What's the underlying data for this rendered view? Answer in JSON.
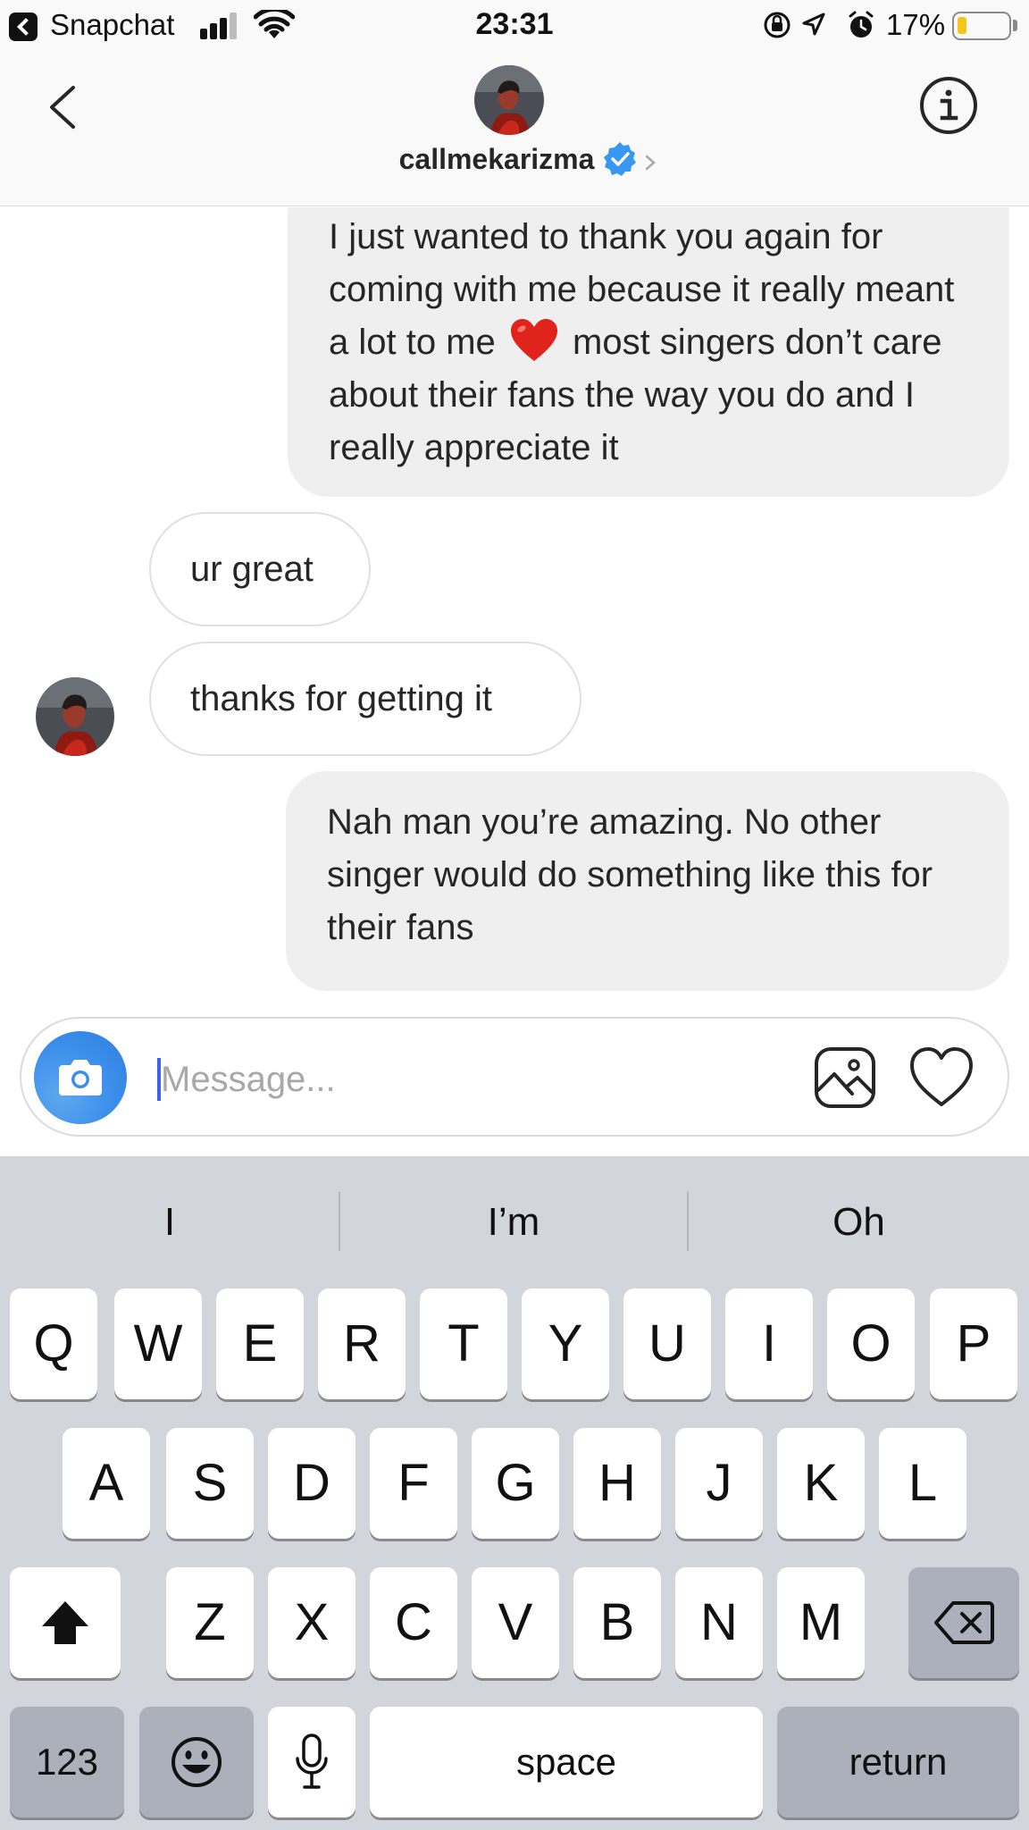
{
  "status_bar": {
    "back_app": "Snapchat",
    "time": "23:31",
    "battery_percent": "17%",
    "battery_level": 0.17,
    "battery_color": "#f5c518",
    "icons": [
      "signal-icon",
      "wifi-icon",
      "rotation-lock-icon",
      "location-icon",
      "alarm-icon",
      "battery-icon"
    ]
  },
  "header": {
    "username": "callmekarizma",
    "verified": true,
    "verified_color": "#3897f0",
    "icons": [
      "back-chevron-icon",
      "verified-badge-icon",
      "chevron-right-icon",
      "info-icon"
    ]
  },
  "messages": [
    {
      "sender": "me",
      "text_before_emoji": "I just wanted to thank you again for coming with me because it really meant a lot to me",
      "emoji": "red-heart",
      "text_after_emoji": "most singers don’t care about their fans the way you do and I really appreciate it"
    },
    {
      "sender": "callmekarizma",
      "text": "ur great"
    },
    {
      "sender": "callmekarizma",
      "text": "thanks for getting it"
    },
    {
      "sender": "me",
      "text": "Nah man you’re amazing. No other singer would do something like this for their fans"
    }
  ],
  "composer": {
    "placeholder": "Message...",
    "value": "",
    "accent": "#3b8eea",
    "icons": [
      "camera-icon",
      "gallery-icon",
      "heart-icon"
    ]
  },
  "keyboard": {
    "suggestions": [
      "I",
      "I’m",
      "Oh"
    ],
    "row1": [
      "Q",
      "W",
      "E",
      "R",
      "T",
      "Y",
      "U",
      "I",
      "O",
      "P"
    ],
    "row2": [
      "A",
      "S",
      "D",
      "F",
      "G",
      "H",
      "J",
      "K",
      "L"
    ],
    "row3": [
      "Z",
      "X",
      "C",
      "V",
      "B",
      "N",
      "M"
    ],
    "numbers_label": "123",
    "space_label": "space",
    "return_label": "return",
    "icons": [
      "shift-icon",
      "delete-icon",
      "emoji-icon",
      "microphone-icon"
    ]
  }
}
